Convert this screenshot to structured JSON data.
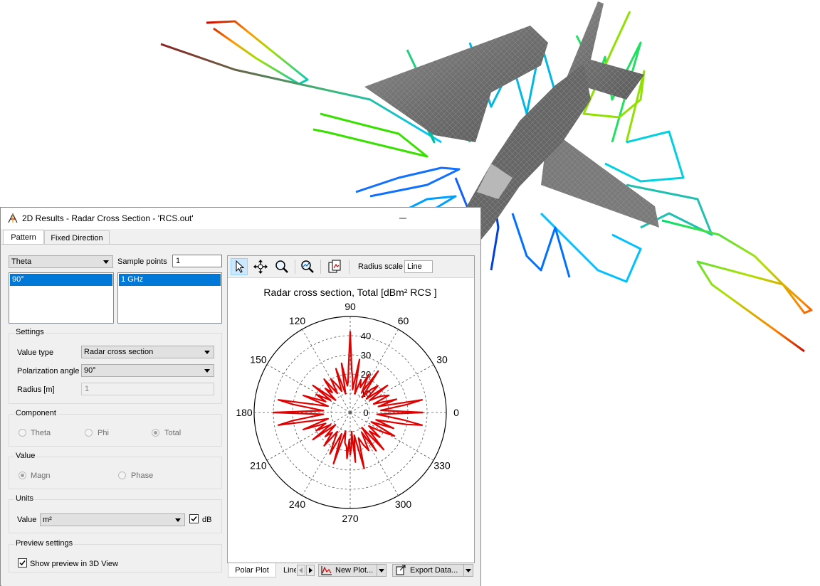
{
  "window": {
    "title": "2D Results - Radar Cross Section - 'RCS.out'"
  },
  "tabs": [
    {
      "label": "Pattern",
      "active": true
    },
    {
      "label": "Fixed Direction",
      "active": false
    }
  ],
  "variable": {
    "selected": "Theta",
    "items": [
      "90°"
    ]
  },
  "sample_points": {
    "label": "Sample points",
    "value": "1",
    "items": [
      "1 GHz"
    ]
  },
  "settings": {
    "title": "Settings",
    "value_type": {
      "label": "Value type",
      "value": "Radar cross section"
    },
    "polarization_angle": {
      "label": "Polarization angle",
      "value": "90°"
    },
    "radius": {
      "label": "Radius [m]",
      "value": "1"
    }
  },
  "component": {
    "title": "Component",
    "options": [
      "Theta",
      "Phi",
      "Total"
    ],
    "selected": "Total"
  },
  "value_group": {
    "title": "Value",
    "options": [
      "Magn",
      "Phase"
    ],
    "selected": "Magn"
  },
  "units": {
    "title": "Units",
    "value_label": "Value",
    "value": "m²",
    "db_label": "dB",
    "db_checked": true
  },
  "preview": {
    "title": "Preview settings",
    "show_label": "Show preview in 3D View",
    "checked": true
  },
  "toolbar": {
    "icons": [
      "pointer-icon",
      "pan-icon",
      "zoom-icon",
      "zoom-fit-icon",
      "copy-image-icon"
    ],
    "radius_scale_label": "Radius scale",
    "radius_scale_value": "Line"
  },
  "bottom": {
    "tabs": [
      "Polar Plot",
      "Line"
    ],
    "new_plot_label": "New Plot...",
    "export_label": "Export Data..."
  },
  "chart_data": {
    "type": "polar-line",
    "title": "Radar cross section, Total  [dBm² RCS ]",
    "angle_unit": "degrees",
    "angle_ticks": [
      0,
      30,
      60,
      90,
      120,
      150,
      180,
      210,
      240,
      270,
      300,
      330
    ],
    "radial_ticks": [
      0,
      10,
      20,
      30,
      40
    ],
    "rlim": [
      0,
      50
    ],
    "grid": true,
    "line_color": "#e00000",
    "series": [
      {
        "angles": [
          0,
          4,
          8,
          10,
          12,
          16,
          20,
          24,
          28,
          32,
          36,
          40,
          44,
          48,
          52,
          56,
          60,
          64,
          68,
          72,
          76,
          80,
          84,
          86,
          88,
          90,
          92,
          94,
          96,
          100,
          104,
          108,
          112,
          116,
          120,
          124,
          128,
          132,
          136,
          140,
          144,
          148,
          152,
          156,
          160,
          164,
          168,
          170,
          172,
          176,
          180,
          184,
          188,
          190,
          192,
          196,
          200,
          204,
          208,
          212,
          216,
          220,
          224,
          228,
          232,
          236,
          240,
          244,
          248,
          252,
          256,
          260,
          264,
          266,
          268,
          270,
          272,
          274,
          276,
          280,
          284,
          288,
          292,
          296,
          300,
          304,
          308,
          312,
          316,
          320,
          324,
          328,
          332,
          336,
          340,
          344,
          348,
          350,
          352,
          356
        ],
        "r": [
          38,
          16,
          30,
          38,
          15,
          25,
          13,
          22,
          18,
          12,
          24,
          11,
          20,
          16,
          10,
          26,
          12,
          22,
          14,
          18,
          10,
          28,
          12,
          18,
          22,
          42,
          24,
          16,
          14,
          26,
          10,
          24,
          12,
          16,
          20,
          12,
          22,
          14,
          18,
          10,
          24,
          12,
          20,
          14,
          26,
          12,
          22,
          38,
          30,
          14,
          40,
          14,
          30,
          38,
          22,
          12,
          26,
          14,
          20,
          12,
          24,
          10,
          18,
          14,
          22,
          12,
          16,
          24,
          12,
          28,
          10,
          16,
          18,
          24,
          14,
          22,
          18,
          10,
          26,
          12,
          30,
          14,
          18,
          22,
          12,
          24,
          10,
          26,
          14,
          20,
          12,
          18,
          26,
          12,
          24,
          14,
          30,
          38,
          28,
          14
        ]
      }
    ]
  }
}
